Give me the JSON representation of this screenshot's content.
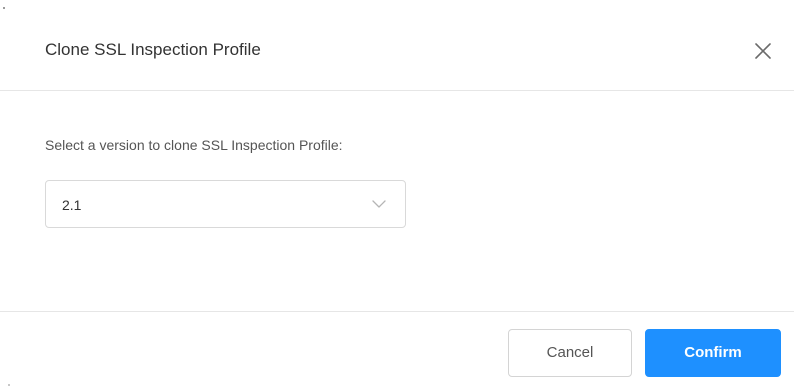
{
  "dialog": {
    "title": "Clone SSL Inspection Profile",
    "close_icon": "close-icon"
  },
  "body": {
    "prompt": "Select a version to clone SSL Inspection Profile:",
    "version_select": {
      "selected": "2.1",
      "chevron_icon": "chevron-down-icon"
    }
  },
  "footer": {
    "cancel_label": "Cancel",
    "confirm_label": "Confirm"
  },
  "colors": {
    "primary": "#1e90ff",
    "border": "#d9d9d9",
    "divider": "#e6e6e6",
    "text": "#333333"
  }
}
